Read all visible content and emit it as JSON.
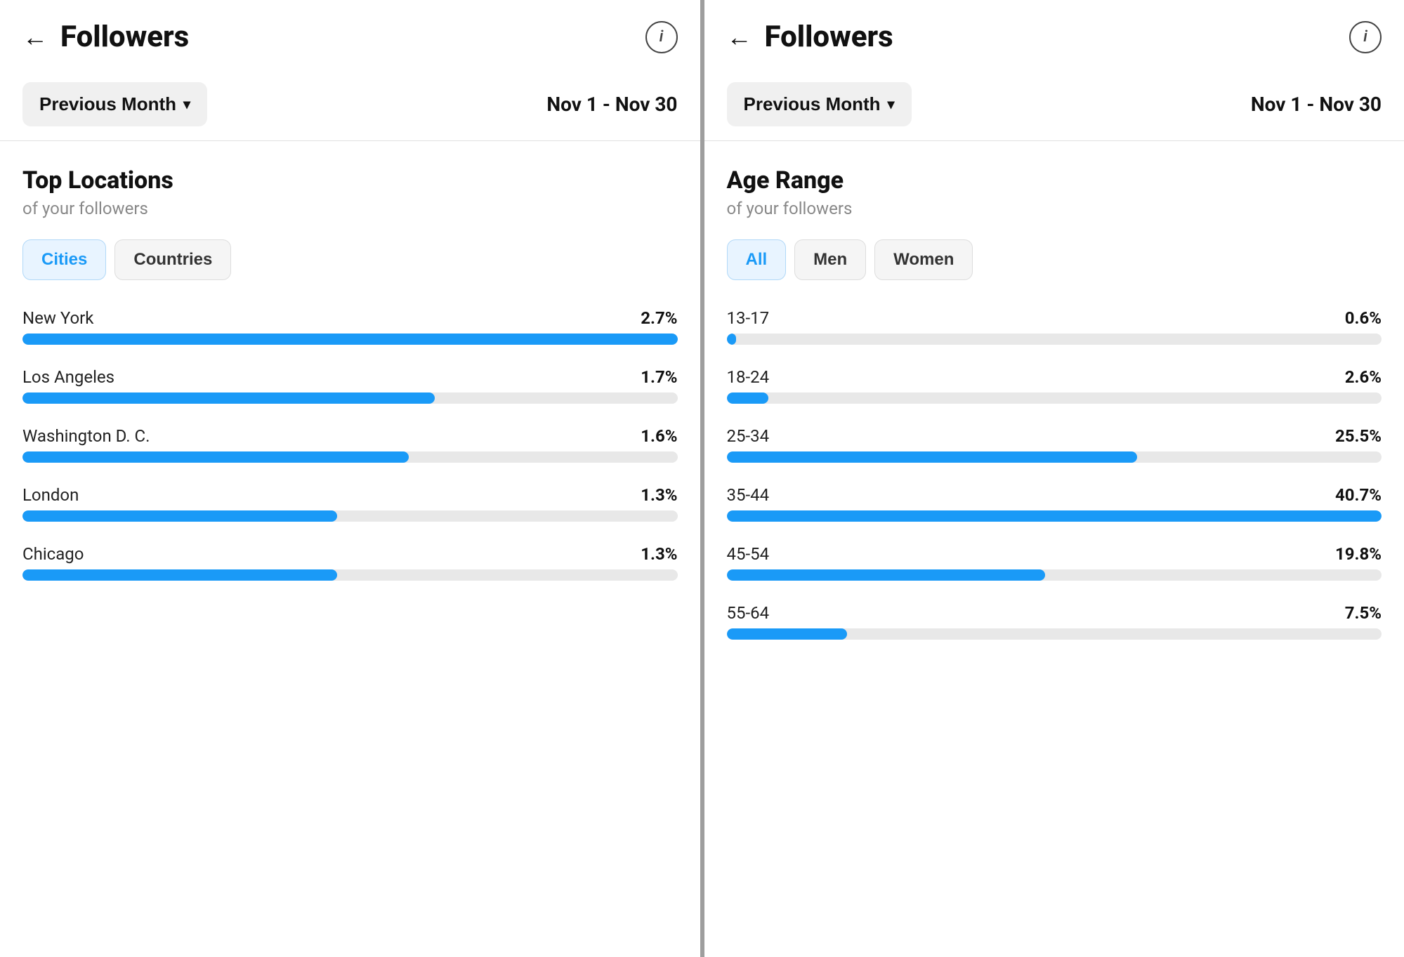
{
  "left_panel": {
    "header": {
      "back_label": "←",
      "title": "Followers",
      "info_label": "i"
    },
    "filter": {
      "period_label": "Previous Month",
      "chevron": "▾",
      "date_range": "Nov 1 - Nov 30"
    },
    "content": {
      "section_title": "Top Locations",
      "section_subtitle": "of your followers",
      "tabs": [
        {
          "id": "cities",
          "label": "Cities",
          "active": true
        },
        {
          "id": "countries",
          "label": "Countries",
          "active": false
        }
      ],
      "cities": [
        {
          "name": "New York",
          "pct": "2.7%",
          "pct_num": 2.7
        },
        {
          "name": "Los Angeles",
          "pct": "1.7%",
          "pct_num": 1.7
        },
        {
          "name": "Washington D. C.",
          "pct": "1.6%",
          "pct_num": 1.6
        },
        {
          "name": "London",
          "pct": "1.3%",
          "pct_num": 1.3
        },
        {
          "name": "Chicago",
          "pct": "1.3%",
          "pct_num": 1.3
        }
      ]
    }
  },
  "right_panel": {
    "header": {
      "back_label": "←",
      "title": "Followers",
      "info_label": "i"
    },
    "filter": {
      "period_label": "Previous Month",
      "chevron": "▾",
      "date_range": "Nov 1 - Nov 30"
    },
    "content": {
      "section_title": "Age Range",
      "section_subtitle": "of your followers",
      "tabs": [
        {
          "id": "all",
          "label": "All",
          "active": true
        },
        {
          "id": "men",
          "label": "Men",
          "active": false
        },
        {
          "id": "women",
          "label": "Women",
          "active": false
        }
      ],
      "age_ranges": [
        {
          "range": "13-17",
          "pct": "0.6%",
          "pct_num": 0.6
        },
        {
          "range": "18-24",
          "pct": "2.6%",
          "pct_num": 2.6
        },
        {
          "range": "25-34",
          "pct": "25.5%",
          "pct_num": 25.5
        },
        {
          "range": "35-44",
          "pct": "40.7%",
          "pct_num": 40.7
        },
        {
          "range": "45-54",
          "pct": "19.8%",
          "pct_num": 19.8
        },
        {
          "range": "55-64",
          "pct": "7.5%",
          "pct_num": 7.5
        }
      ]
    }
  },
  "colors": {
    "bar_fill": "#1a9af7",
    "bar_track": "#e8e8e8"
  }
}
